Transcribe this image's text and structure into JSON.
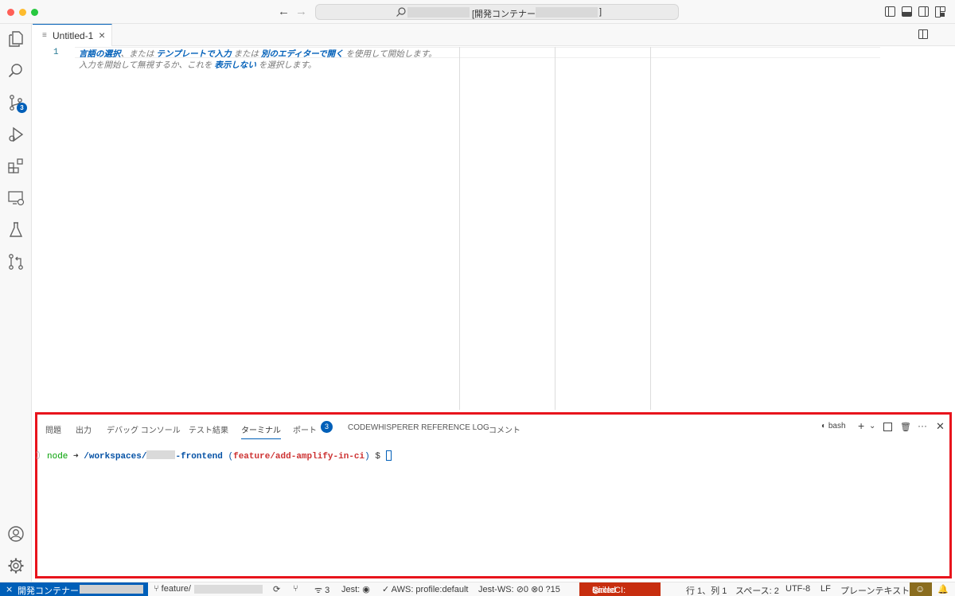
{
  "window": {
    "title_bracket_open": "[開発コンテナー:",
    "title_bracket_close": "]"
  },
  "tab": {
    "label": "Untitled-1",
    "close": "×"
  },
  "editor": {
    "line_number": "1",
    "hint_line1": [
      {
        "text": "言語の選択",
        "link": true
      },
      {
        "text": "、または ",
        "link": false
      },
      {
        "text": "テンプレートで入力",
        "link": true
      },
      {
        "text": " または ",
        "link": false
      },
      {
        "text": "別のエディターで開く",
        "link": true
      },
      {
        "text": " を使用して開始します。",
        "link": false
      }
    ],
    "hint_line2": [
      {
        "text": "入力を開始して無視するか、これを ",
        "link": false
      },
      {
        "text": "表示しない",
        "link": true
      },
      {
        "text": " を選択します。",
        "link": false
      }
    ]
  },
  "panel": {
    "tabs": [
      "問題",
      "出力",
      "デバッグ コンソール",
      "テスト結果",
      "ターミナル",
      "ポート",
      "CODEWHISPERER REFERENCE LOG",
      "コメント"
    ],
    "active_tab": "ターミナル",
    "ports_badge": "3",
    "shell": "bash",
    "terminal": {
      "node": "node",
      "arrow": "➜",
      "path_prefix": "/workspaces/",
      "path_suffix": "-frontend",
      "branch_open": "(",
      "branch": "feature/add-amplify-in-ci",
      "branch_close": ")",
      "prompt": "$"
    }
  },
  "activity": {
    "scm_badge": "3"
  },
  "status": {
    "remote_label": "開発コンテナー:",
    "branch_prefix": "feature/",
    "ports": "3",
    "jest": "Jest:",
    "aws": "AWS: profile:default",
    "jest_ws": "Jest-WS:",
    "jest_ws_pass": "0",
    "jest_ws_fail": "0",
    "jest_ws_unknown": "15",
    "circleci": "CircleCI:",
    "circleci_state": "Failed",
    "cursor_pos": "行 1、列 1",
    "spaces": "スペース: 2",
    "encoding": "UTF-8",
    "eol": "LF",
    "language": "プレーンテキスト"
  }
}
